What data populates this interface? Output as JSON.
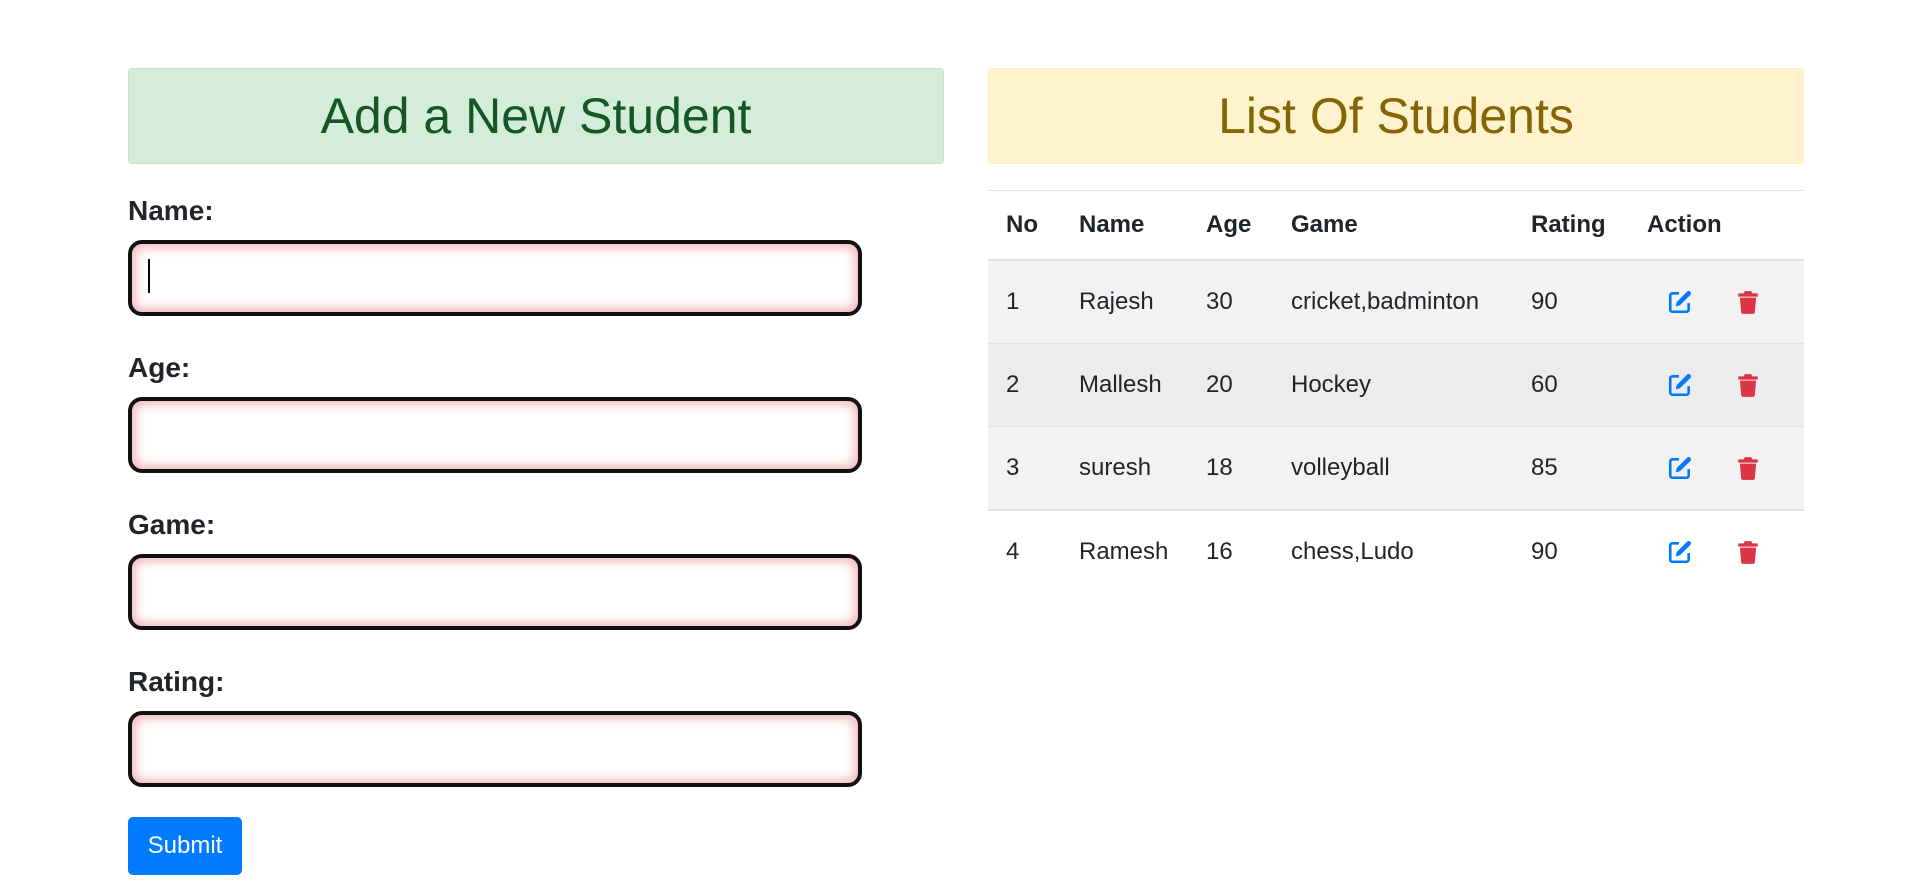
{
  "form": {
    "title": "Add a New Student",
    "fields": [
      {
        "label": "Name:",
        "value": "",
        "placeholder": ""
      },
      {
        "label": "Age:",
        "value": "",
        "placeholder": ""
      },
      {
        "label": "Game:",
        "value": "",
        "placeholder": ""
      },
      {
        "label": "Rating:",
        "value": "",
        "placeholder": ""
      }
    ],
    "submit_label": "Submit"
  },
  "list": {
    "title": "List Of Students",
    "columns": [
      "No",
      "Name",
      "Age",
      "Game",
      "Rating",
      "Action"
    ],
    "rows": [
      {
        "no": "1",
        "name": "Rajesh",
        "age": "30",
        "game": "cricket,badminton",
        "rating": "90"
      },
      {
        "no": "2",
        "name": "Mallesh",
        "age": "20",
        "game": "Hockey",
        "rating": "60"
      },
      {
        "no": "3",
        "name": "suresh",
        "age": "18",
        "game": "volleyball",
        "rating": "85"
      },
      {
        "no": "4",
        "name": "Ramesh",
        "age": "16",
        "game": "chess,Ludo",
        "rating": "90"
      }
    ],
    "row_actions": [
      "edit-icon",
      "trash-icon"
    ]
  },
  "colors": {
    "success_bg": "#d4edda",
    "success_text": "#155724",
    "warning_bg": "#fff3cd",
    "warning_text": "#856404",
    "primary": "#007bff",
    "danger": "#dc3545"
  }
}
